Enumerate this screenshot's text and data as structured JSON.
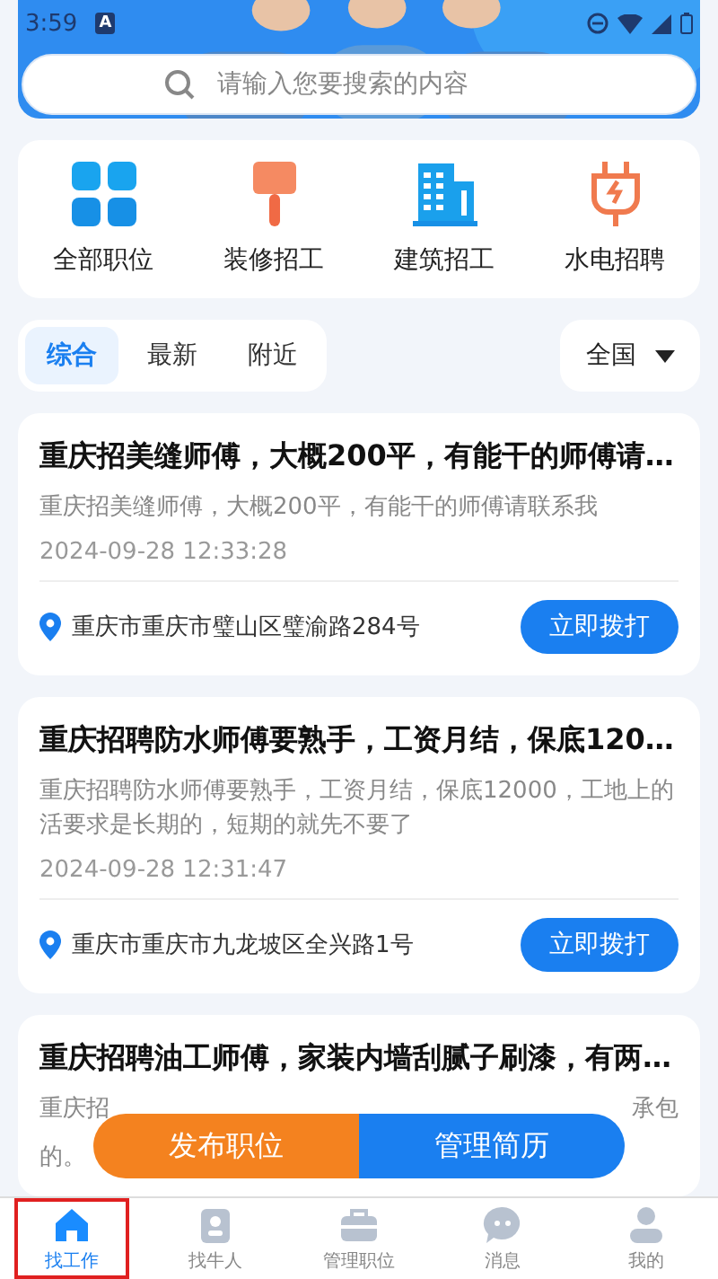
{
  "status_bar": {
    "time": "3:59",
    "badge": "A"
  },
  "search": {
    "placeholder": "请输入您要搜索的内容"
  },
  "categories": [
    {
      "label": "全部职位",
      "kind": "grid"
    },
    {
      "label": "装修招工",
      "kind": "roller"
    },
    {
      "label": "建筑招工",
      "kind": "building"
    },
    {
      "label": "水电招聘",
      "kind": "plug"
    }
  ],
  "filter_tabs": [
    {
      "label": "综合",
      "selected": true
    },
    {
      "label": "最新",
      "selected": false
    },
    {
      "label": "附近",
      "selected": false
    }
  ],
  "region": {
    "label": "全国"
  },
  "jobs": [
    {
      "title": "重庆招美缝师傅，大概200平，有能干的师傅请…",
      "description": "重庆招美缝师傅，大概200平，有能干的师傅请联系我",
      "time": "2024-09-28 12:33:28",
      "address": "重庆市重庆市璧山区璧渝路284号",
      "action": "立即拨打"
    },
    {
      "title": "重庆招聘防水师傅要熟手，工资月结，保底120…",
      "description": "重庆招聘防水师傅要熟手，工资月结，保底12000，工地上的活要求是长期的，短期的就先不要了",
      "time": "2024-09-28 12:31:47",
      "address": "重庆市重庆市九龙坡区全兴路1号",
      "action": "立即拨打"
    }
  ],
  "partial_job": {
    "title": "重庆招聘油工师傅，家装内墙刮腻子刷漆，有两…",
    "description_start": "重庆招",
    "description_end": "承包",
    "description_line2": "的。"
  },
  "floating_actions": [
    {
      "label": "发布职位",
      "kind": "post"
    },
    {
      "label": "管理简历",
      "kind": "manage"
    }
  ],
  "bottom_nav": [
    {
      "label": "找工作",
      "kind": "home",
      "selected": true,
      "highlighted": true
    },
    {
      "label": "找牛人",
      "kind": "person-card",
      "selected": false,
      "highlighted": false
    },
    {
      "label": "管理职位",
      "kind": "briefcase",
      "selected": false,
      "highlighted": false
    },
    {
      "label": "消息",
      "kind": "chat",
      "selected": false,
      "highlighted": false
    },
    {
      "label": "我的",
      "kind": "user",
      "selected": false,
      "highlighted": false
    }
  ]
}
